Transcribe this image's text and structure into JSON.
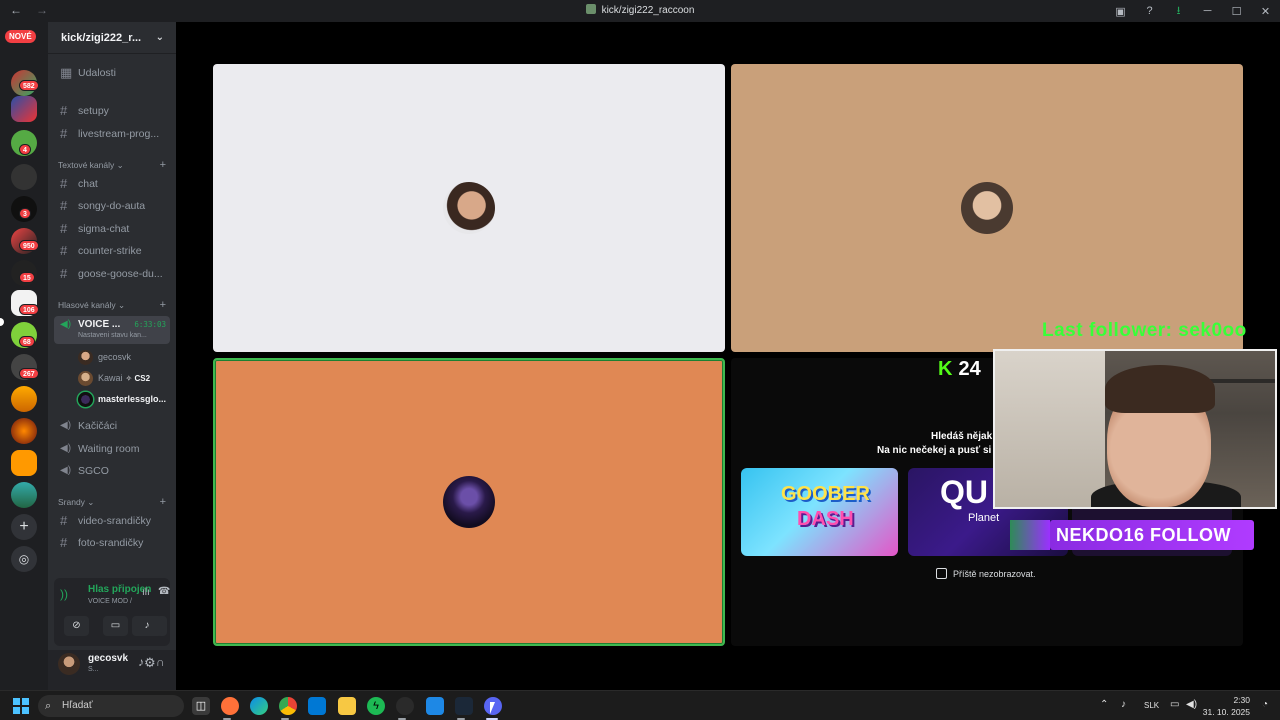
{
  "window": {
    "title": "kick/zigi222_raccoon",
    "back_label": "←",
    "forward_label": "→"
  },
  "servers": {
    "nove_label": "NOVÉ",
    "badges": [
      "582",
      "4",
      "3",
      "950",
      "15",
      "106",
      "68",
      "267"
    ]
  },
  "guild": {
    "name": "kick/zigi222_r...",
    "events_label": "Udalosti",
    "top_channels": [
      "setupy",
      "livestream-prog..."
    ],
    "text_category": "Textové kanály",
    "text_channels": [
      "chat",
      "songy-do-auta",
      "sigma-chat",
      "counter-strike",
      "goose-goose-du..."
    ],
    "voice_category": "Hlasové kanály",
    "active_voice": {
      "name": "VOICE ...",
      "timer": "6:33:03",
      "status": "Nastaveni stavu kan..."
    },
    "voice_members": [
      {
        "name": "gecosvk",
        "tag": ""
      },
      {
        "name": "Kawai",
        "tag": "CS2"
      },
      {
        "name": "masterlessglo...",
        "tag": ""
      }
    ],
    "other_voice": [
      "Kačičáci",
      "Waiting room",
      "SGCO"
    ],
    "srandy_category": "Srandy",
    "srandy_channels": [
      "video-srandičky",
      "foto-srandičky"
    ]
  },
  "voice_panel": {
    "status": "Hlas připojen",
    "sub": "VOICE MOD / "
  },
  "user": {
    "name": "gecosvk",
    "status": "S..."
  },
  "stage": {
    "tile_colors": [
      "#ebebef",
      "#c9a07a",
      "#e08854"
    ],
    "last_follower": "Last follower: sek0oo",
    "kick_count": "24",
    "promo_line1": "Hledáš nějak",
    "promo_line2": "Na nic nečekej a pusť si n",
    "games": [
      "GOOBER",
      "DASH",
      "QU",
      "Planet"
    ],
    "follow_overlay": "NEKDO16 FOLLOW",
    "dont_show": "Příště nezobrazovat."
  },
  "taskbar": {
    "search_placeholder": "Hľadať",
    "lang": "SLK",
    "time": "2:30",
    "date": "31. 10. 2025"
  }
}
